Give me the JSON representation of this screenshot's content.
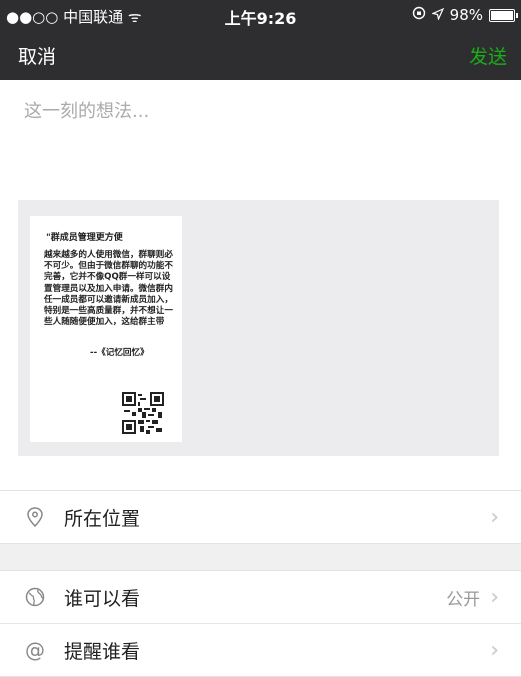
{
  "status_bar": {
    "carrier": "●●○○ 中国联通 ᯤ",
    "time": "上午9:26",
    "battery": "98%",
    "battery_level": 0.98
  },
  "nav": {
    "cancel": "取消",
    "send": "发送",
    "send_color": "#1aad19"
  },
  "compose": {
    "placeholder": "这一刻的想法..."
  },
  "attachment_card": {
    "title": "\"群成员管理更方便",
    "body": "越来越多的人使用微信，群聊则必不可少。但由于微信群聊的功能不完善，它并不像QQ群一样可以设置管理员以及加入申请。微信群内任一成员都可以邀请新成员加入，特别是一些高质量群，并不想让一些人随随便便加入，这给群主带",
    "source": "--《记忆回忆》"
  },
  "options": {
    "location": {
      "label": "所在位置",
      "icon": "location-pin-icon"
    },
    "visibility": {
      "label": "谁可以看",
      "value": "公开",
      "icon": "globe-icon"
    },
    "mention": {
      "label": "提醒谁看",
      "icon": "at-sign-icon"
    }
  }
}
